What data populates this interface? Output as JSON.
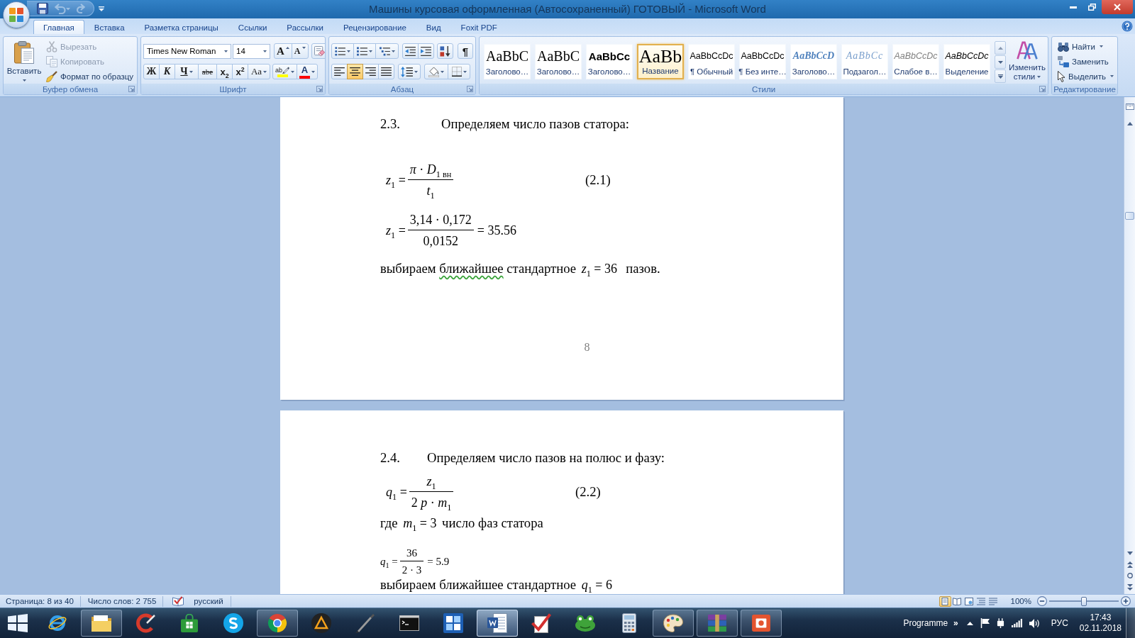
{
  "window": {
    "title": "Машины курсовая оформленная (Автосохраненный) ГОТОВЫЙ - Microsoft Word"
  },
  "quick_access": [
    {
      "kind": "save",
      "disabled": false
    },
    {
      "kind": "undo",
      "disabled": true
    },
    {
      "kind": "redo",
      "disabled": true
    },
    {
      "kind": "customize",
      "disabled": false
    }
  ],
  "tabs": [
    {
      "label": "Главная",
      "selected": true
    },
    {
      "label": "Вставка",
      "selected": false
    },
    {
      "label": "Разметка страницы",
      "selected": false
    },
    {
      "label": "Ссылки",
      "selected": false
    },
    {
      "label": "Рассылки",
      "selected": false
    },
    {
      "label": "Рецензирование",
      "selected": false
    },
    {
      "label": "Вид",
      "selected": false
    },
    {
      "label": "Foxit PDF",
      "selected": false
    }
  ],
  "ribbon": {
    "clipboard": {
      "title": "Буфер обмена",
      "launcher": true,
      "paste": "Вставить",
      "commands": [
        {
          "kind": "cut",
          "label": "Вырезать",
          "disabled": true
        },
        {
          "kind": "copy",
          "label": "Копировать",
          "disabled": true
        },
        {
          "kind": "format_painter",
          "label": "Формат по образцу",
          "disabled": false
        }
      ]
    },
    "font": {
      "title": "Шрифт",
      "launcher": true,
      "font_name": "Times New Roman",
      "font_size": "14",
      "size_buttons": [
        {
          "kind": "grow",
          "label": "A"
        },
        {
          "kind": "shrink",
          "label": "A"
        }
      ],
      "clear_buttons": [
        {
          "kind": "clear"
        }
      ],
      "format_buttons": [
        {
          "kind": "bold",
          "label": "Ж",
          "dropdown": false
        },
        {
          "kind": "italic",
          "label": "К",
          "dropdown": false
        },
        {
          "kind": "underline",
          "label": "Ч",
          "dropdown": true
        },
        {
          "kind": "strike",
          "label": "abe",
          "dropdown": false
        },
        {
          "kind": "subscript",
          "label": "x$_{2}$",
          "dropdown": false
        },
        {
          "kind": "superscript",
          "label": "x$^{2}$",
          "dropdown": false
        },
        {
          "kind": "case",
          "label": "Aa",
          "dropdown": true
        }
      ],
      "color_buttons": [
        {
          "kind": "highlight",
          "label": "ab",
          "color": "#ffff00",
          "dropdown": true
        },
        {
          "kind": "font_color",
          "label": "A",
          "color": "#ff0000",
          "dropdown": true
        }
      ]
    },
    "paragraph": {
      "title": "Абзац",
      "launcher": true,
      "list_buttons": [
        {
          "kind": "bullets",
          "dropdown": true
        },
        {
          "kind": "numbering",
          "dropdown": true
        },
        {
          "kind": "multilevel",
          "dropdown": true
        }
      ],
      "indent_buttons": [
        {
          "kind": "outdent",
          "dropdown": false
        },
        {
          "kind": "indent",
          "dropdown": false
        }
      ],
      "sort_buttons": [
        {
          "kind": "sort",
          "dropdown": false
        }
      ],
      "marks_buttons": [
        {
          "kind": "marks",
          "label": "¶",
          "dropdown": false
        }
      ],
      "align_buttons": [
        {
          "kind": "left",
          "selected": false
        },
        {
          "kind": "center",
          "selected": true
        },
        {
          "kind": "right",
          "selected": false
        },
        {
          "kind": "justify",
          "selected": false
        }
      ],
      "spacing_buttons": [
        {
          "kind": "line_spacing",
          "dropdown": true
        }
      ],
      "fill_buttons": [
        {
          "kind": "shading",
          "dropdown": true
        },
        {
          "kind": "borders",
          "dropdown": true
        }
      ]
    },
    "styles": {
      "title": "Стили",
      "launcher": true,
      "items": [
        {
          "kind": "heading1",
          "preview": "AaBbC",
          "label": "Заголово…",
          "selected": false
        },
        {
          "kind": "heading2",
          "preview": "AaBbC",
          "label": "Заголово…",
          "selected": false
        },
        {
          "kind": "heading_bold",
          "preview": "AaBbCc",
          "label": "Заголово…",
          "selected": false
        },
        {
          "kind": "title",
          "preview": "AaBb",
          "label": "Название",
          "selected": true
        },
        {
          "kind": "normal",
          "preview": "AaBbCcDc",
          "label": "¶ Обычный",
          "selected": false
        },
        {
          "kind": "no_spacing",
          "preview": "AaBbCcDc",
          "label": "¶ Без инте…",
          "selected": false
        },
        {
          "kind": "heading3",
          "preview": "AaBbCcD",
          "label": "Заголово…",
          "selected": false
        },
        {
          "kind": "subtitle",
          "preview": "AaBbCc",
          "label": "Подзагол…",
          "selected": false
        },
        {
          "kind": "subtle",
          "preview": "AaBbCcDc",
          "label": "Слабое в…",
          "selected": false
        },
        {
          "kind": "emphasis",
          "preview": "AaBbCcDc",
          "label": "Выделение",
          "selected": false
        }
      ],
      "change_styles": "Изменить стили"
    },
    "editing": {
      "title": "Редактирование",
      "launcher": false,
      "items": [
        {
          "kind": "find",
          "label": "Найти",
          "dropdown": true
        },
        {
          "kind": "replace",
          "label": "Заменить",
          "dropdown": false
        },
        {
          "kind": "select",
          "label": "Выделить",
          "dropdown": true
        }
      ]
    }
  },
  "document": {
    "pages": [
      {
        "page_number": "8",
        "blocks": [
          {
            "kind": "heading",
            "number": "2.3.",
            "text": "Определяем число пазов статора:"
          },
          {
            "kind": "formula",
            "lhs": "*z*$_{1}$ =",
            "numerator": "*π* · *D*$_{1 вн}$",
            "denominator": "*t*$_{1}$",
            "equation_number": "(2.1)"
          },
          {
            "kind": "formula",
            "lhs": "*z*$_{1}$ =",
            "numerator": "3,14 · 0,172",
            "denominator": "0,0152",
            "rhs": "= 35.56"
          },
          {
            "kind": "paragraph",
            "segments": [
              {
                "kind": "text",
                "text": "выбираем ",
                "flagged": false
              },
              {
                "kind": "text",
                "text": "ближайшее",
                "flagged": true
              },
              {
                "kind": "text",
                "text": " стандартное ",
                "flagged": false
              },
              {
                "kind": "math",
                "text": "*z*$_{1}$ = 36",
                "flagged": false
              },
              {
                "kind": "text",
                "text": "  пазов.",
                "flagged": false
              }
            ]
          }
        ]
      },
      {
        "blocks": [
          {
            "kind": "heading",
            "number": "2.4.",
            "text": "Определяем число пазов на полюс и фазу:"
          },
          {
            "kind": "formula",
            "lhs": "*q*$_{1}$ =",
            "numerator": "*z*$_{1}$",
            "denominator": "2 *p* · *m*$_{1}$",
            "equation_number": "(2.2)"
          },
          {
            "kind": "paragraph",
            "segments": [
              {
                "kind": "text",
                "text": "где ",
                "flagged": false
              },
              {
                "kind": "math",
                "text": "*m*$_{1}$ = 3",
                "flagged": false
              },
              {
                "kind": "text",
                "text": " число фаз статора",
                "flagged": false
              }
            ]
          },
          {
            "kind": "compact_formula",
            "lhs": "*q*$_{1}$ =",
            "numerator": "36",
            "denominator": "2 · 3",
            "rhs": "= 5.9"
          },
          {
            "kind": "paragraph",
            "segments": [
              {
                "kind": "text",
                "text": "выбираем ближайшее стандартное ",
                "flagged": false
              },
              {
                "kind": "math",
                "text": "*q*$_{1}$ = 6",
                "flagged": false
              }
            ]
          }
        ]
      }
    ]
  },
  "status_bar": {
    "page": "Страница: 8 из 40",
    "words": "Число слов: 2 755",
    "language": "русский",
    "views": [
      {
        "kind": "print_layout",
        "selected": true
      },
      {
        "kind": "reading",
        "selected": false
      },
      {
        "kind": "web_layout",
        "selected": false
      },
      {
        "kind": "outline",
        "selected": false
      },
      {
        "kind": "draft",
        "selected": false
      }
    ],
    "zoom": "100%",
    "zoom_slider": {
      "level": 0.5
    }
  },
  "taskbar": {
    "apps": [
      {
        "kind": "browser",
        "running": false,
        "selected": false
      },
      {
        "kind": "folder",
        "running": true,
        "selected": false
      },
      {
        "kind": "red_arc",
        "running": false,
        "selected": false
      },
      {
        "kind": "shopping_bag",
        "running": false,
        "selected": false
      },
      {
        "kind": "swirl_circle",
        "running": false,
        "selected": false
      },
      {
        "kind": "segmented_circle",
        "running": true,
        "selected": false
      },
      {
        "kind": "triangle_circle",
        "running": false,
        "selected": false
      },
      {
        "kind": "stylus",
        "running": false,
        "selected": false
      },
      {
        "kind": "terminal",
        "running": false,
        "selected": false
      },
      {
        "kind": "tools_tile",
        "running": false,
        "selected": false
      },
      {
        "kind": "document",
        "running": true,
        "selected": true
      },
      {
        "kind": "checkmark",
        "running": false,
        "selected": false
      },
      {
        "kind": "frog",
        "running": false,
        "selected": false
      },
      {
        "kind": "calculator",
        "running": false,
        "selected": false
      },
      {
        "kind": "palette",
        "running": true,
        "selected": false
      },
      {
        "kind": "books",
        "running": true,
        "selected": false
      },
      {
        "kind": "presentation",
        "running": true,
        "selected": false
      }
    ],
    "toolbar": "Programme",
    "chevron": "»",
    "tray": [
      {
        "kind": "show_hidden"
      },
      {
        "kind": "flag"
      },
      {
        "kind": "plug"
      },
      {
        "kind": "signal"
      },
      {
        "kind": "volume"
      }
    ],
    "language": "РУС",
    "time": "17:43",
    "date": "02.11.2018"
  }
}
